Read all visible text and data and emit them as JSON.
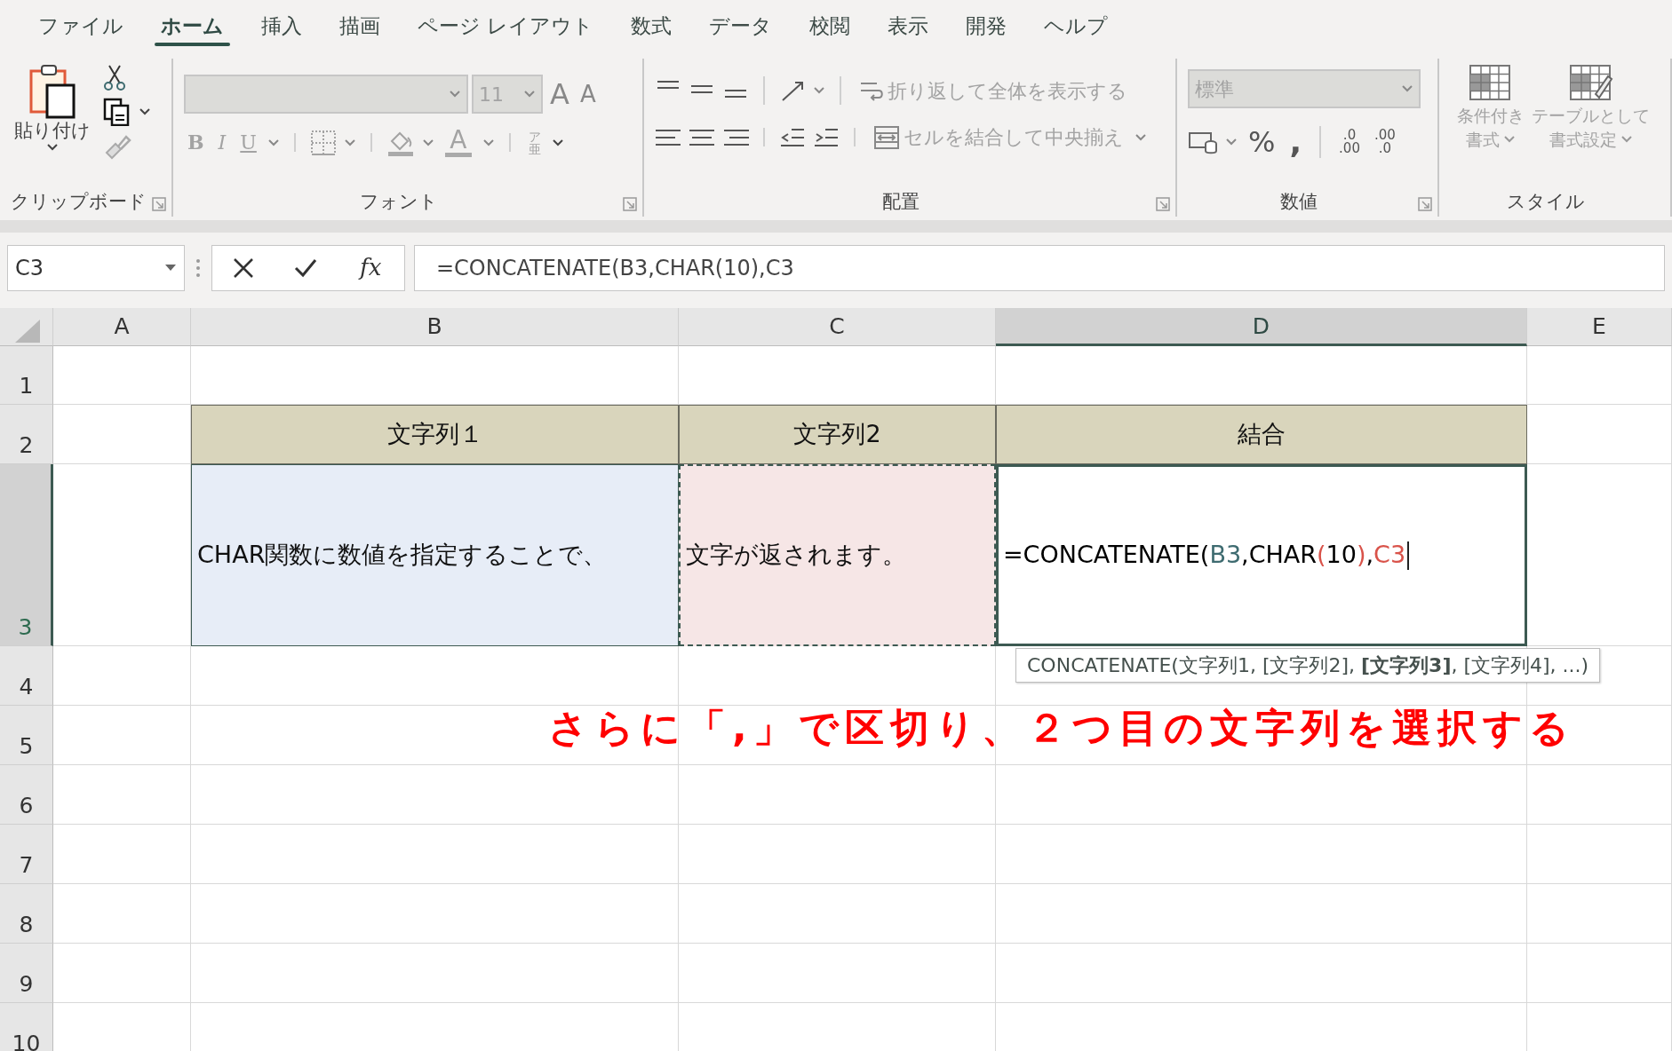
{
  "tabs": [
    {
      "label": "ファイル",
      "selected": false
    },
    {
      "label": "ホーム",
      "selected": true
    },
    {
      "label": "挿入",
      "selected": false
    },
    {
      "label": "描画",
      "selected": false
    },
    {
      "label": "ページ レイアウト",
      "selected": false
    },
    {
      "label": "数式",
      "selected": false
    },
    {
      "label": "データ",
      "selected": false
    },
    {
      "label": "校閲",
      "selected": false
    },
    {
      "label": "表示",
      "selected": false
    },
    {
      "label": "開発",
      "selected": false
    },
    {
      "label": "ヘルプ",
      "selected": false
    }
  ],
  "ribbon": {
    "clipboard": {
      "label": "クリップボード",
      "paste": "貼り付け"
    },
    "font": {
      "label": "フォント",
      "size": "11",
      "grow": "A",
      "shrink": "A",
      "bold": "B",
      "italic": "I",
      "underline": "U",
      "color_glyph": "A",
      "phonetic_top": "ア",
      "phonetic_bottom": "亜",
      "disabled": true
    },
    "alignment": {
      "label": "配置",
      "wrap": "折り返して全体を表示する",
      "merge": "セルを結合して中央揃え",
      "disabled": true
    },
    "number": {
      "label": "数値",
      "format": "標準",
      "percent": "%",
      "comma": ",",
      "decimal_add_top": ".0",
      "decimal_add_bottom": ".00",
      "decimal_remove_top": ".00",
      "decimal_remove_bottom": ".0",
      "disabled": true
    },
    "styles": {
      "label": "スタイル",
      "conditional": [
        "条件付き",
        "書式"
      ],
      "table": [
        "テーブルとして",
        "書式設定"
      ],
      "disabled": true
    }
  },
  "formula_bar": {
    "name_box": "C3",
    "fx": "fx",
    "formula": "=CONCATENATE(B3,CHAR(10),C3"
  },
  "sheet": {
    "columns": [
      {
        "label": "A",
        "selected": false
      },
      {
        "label": "B",
        "selected": false
      },
      {
        "label": "C",
        "selected": false
      },
      {
        "label": "D",
        "selected": true
      },
      {
        "label": "E",
        "selected": false
      }
    ],
    "rows": [
      {
        "label": "1",
        "selected": false,
        "cells": []
      },
      {
        "label": "2",
        "selected": false,
        "cells": [
          "",
          {
            "kind": "header",
            "text": "文字列１"
          },
          {
            "kind": "header",
            "text": "文字列2"
          },
          {
            "kind": "header",
            "text": "結合"
          }
        ]
      },
      {
        "label": "3",
        "selected": true,
        "cells": [
          "",
          {
            "kind": "text",
            "text": "CHAR関数に数値を指定することで、",
            "color": "#e7edf7"
          },
          {
            "kind": "text",
            "text": "文字が返されます。",
            "color": "#f6e6e6",
            "marquee": true
          },
          {
            "kind": "formula",
            "editing": true,
            "segments": [
              {
                "text": "=CONCATENATE(",
                "color": "#000000"
              },
              {
                "text": "B3",
                "color": "#3e6b70"
              },
              {
                "text": ",CHAR",
                "color": "#000000"
              },
              {
                "text": "(",
                "color": "#d9534a"
              },
              {
                "text": "10",
                "color": "#000000"
              },
              {
                "text": ")",
                "color": "#d9534a"
              },
              {
                "text": ",",
                "color": "#000000"
              },
              {
                "text": "C3",
                "color": "#d9534a"
              }
            ]
          }
        ]
      },
      {
        "label": "4",
        "selected": false,
        "cells": []
      },
      {
        "label": "5",
        "selected": false,
        "cells": []
      },
      {
        "label": "6",
        "selected": false,
        "cells": []
      },
      {
        "label": "7",
        "selected": false,
        "cells": []
      },
      {
        "label": "8",
        "selected": false,
        "cells": []
      },
      {
        "label": "9",
        "selected": false,
        "cells": []
      },
      {
        "label": "10",
        "selected": false,
        "cells": []
      }
    ],
    "tooltip": "CONCATENATE(文字列1, [文字列2], **[文字列3]**, [文字列4], ...)",
    "annotation": "さらに「,」で区切り、２つ目の文字列を選択する"
  }
}
